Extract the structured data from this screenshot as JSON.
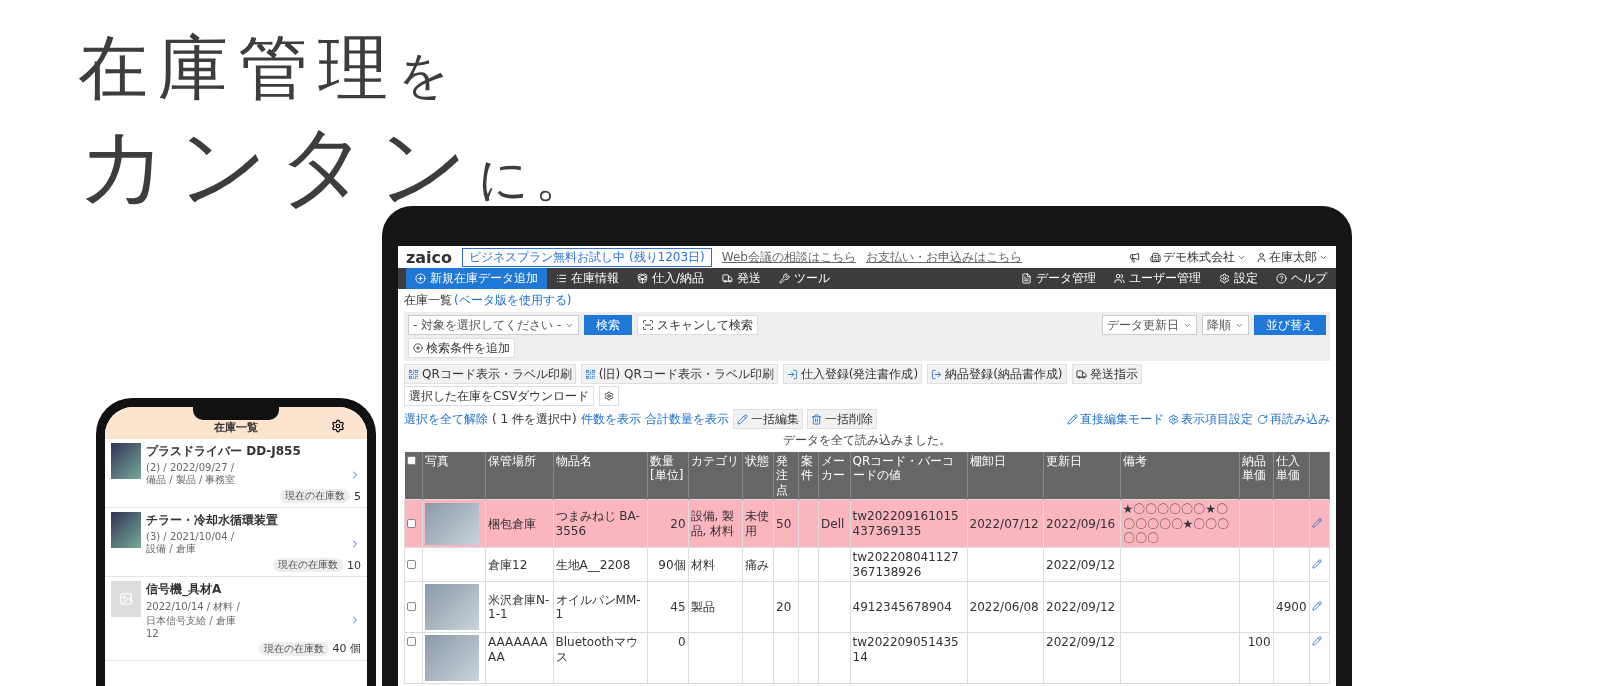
{
  "headline": [
    {
      "main": "在庫管理",
      "tail": "を"
    },
    {
      "main": "カンタン",
      "tail": "に。"
    }
  ],
  "app": {
    "logo": "zaico",
    "trial_badge": "ビジネスプラン無料お試し中 (残り1203日)",
    "top_links": [
      "Web会議の相談はこちら",
      "お支払い・お申込みはこちら"
    ],
    "company": "デモ株式会社",
    "user": "在庫太郎",
    "nav_left": [
      {
        "label": "新規在庫データ追加",
        "kind": "plus",
        "selected": true
      },
      {
        "label": "在庫情報",
        "kind": "list",
        "selected": false
      },
      {
        "label": "仕入/納品",
        "kind": "inbox",
        "selected": false
      },
      {
        "label": "発送",
        "kind": "truck",
        "selected": false
      },
      {
        "label": "ツール",
        "kind": "tool",
        "selected": false
      }
    ],
    "nav_right": [
      {
        "label": "データ管理",
        "kind": "data"
      },
      {
        "label": "ユーザー管理",
        "kind": "users"
      },
      {
        "label": "設定",
        "kind": "settings"
      },
      {
        "label": "ヘルプ",
        "kind": "help"
      }
    ],
    "page_title": "在庫一覧",
    "beta_link": "(ベータ版を使用する)",
    "search": {
      "target_select": "- 対象を選択してください -",
      "search_button": "検索",
      "scan_button": "スキャンして検索",
      "add_condition": "検索条件を追加",
      "sort_field": "データ更新日",
      "sort_order": "降順",
      "sort_button": "並び替え"
    },
    "actions": [
      {
        "label": "QRコード表示・ラベル印刷",
        "kind": "qr"
      },
      {
        "label": "(旧) QRコード表示・ラベル印刷",
        "kind": "qr"
      },
      {
        "label": "仕入登録(発注書作成)",
        "kind": "in"
      },
      {
        "label": "納品登録(納品書作成)",
        "kind": "out"
      },
      {
        "label": "発送指示",
        "kind": "truck"
      }
    ],
    "csv_button": "選択した在庫をCSVダウンロード",
    "selection": {
      "clear": "選択を全て解除",
      "count": "( 1 件を選択中)",
      "show_count": "件数を表示",
      "show_total": "合計数量を表示"
    },
    "bulk": [
      {
        "label": "一括編集",
        "kind": "edit"
      },
      {
        "label": "一括削除",
        "kind": "delete"
      }
    ],
    "view_links": [
      {
        "label": "直接編集モード",
        "kind": "edit"
      },
      {
        "label": "表示項目設定",
        "kind": "settings"
      },
      {
        "label": "再読み込み",
        "kind": "reload"
      }
    ],
    "message": "データを全て読み込みました。",
    "table": {
      "header_checked": false,
      "columns": [
        "写真",
        "保管場所",
        "物品名",
        "数量[単位]",
        "カテゴリ",
        "状態",
        "発注点",
        "案件",
        "メーカー",
        "QRコード・バーコードの値",
        "棚卸日",
        "更新日",
        "備考",
        "納品単価",
        "仕入単価"
      ],
      "rows": [
        {
          "checked": false,
          "highlighted": true,
          "has_photo": true,
          "cells": [
            null,
            "梱包倉庫",
            "つまみねじ BA-3556",
            "20",
            "設備, 製品, 材料",
            "未使用",
            "50",
            null,
            "Dell",
            "tw202209161015437369135",
            "2022/07/12",
            "2022/09/16",
            "★〇〇〇〇〇〇★〇〇〇〇〇〇★〇〇〇〇〇〇",
            null,
            null
          ]
        },
        {
          "checked": false,
          "highlighted": false,
          "has_photo": false,
          "cells": [
            null,
            "倉庫12",
            "生地A__2208",
            "90個",
            "材料",
            "痛み",
            null,
            null,
            null,
            "tw202208041127367138926",
            null,
            "2022/09/12",
            null,
            null,
            null
          ]
        },
        {
          "checked": false,
          "highlighted": false,
          "has_photo": true,
          "cells": [
            null,
            "米沢倉庫N-1-1",
            "オイルパンMM-1",
            "45",
            "製品",
            null,
            "20",
            null,
            null,
            "4912345678904",
            "2022/06/08",
            "2022/09/12",
            null,
            null,
            "4900"
          ]
        },
        {
          "checked": false,
          "highlighted": false,
          "has_photo": true,
          "cells": [
            null,
            "AAAAAAAAA",
            "Bluetoothマウス",
            "0",
            null,
            null,
            null,
            null,
            null,
            "tw20220905143514",
            null,
            "2022/09/12",
            null,
            "100",
            null
          ]
        }
      ]
    }
  },
  "phone": {
    "title": "在庫一覧",
    "items": [
      {
        "title": "プラスドライバー DD-J855",
        "meta": "(2) / 2022/09/27 / 備品 / 製品 / 事務室",
        "stock_label": "現在の在庫数",
        "stock": "5",
        "has_photo": true
      },
      {
        "title": "チラー・冷却水循環装置",
        "meta": "(3) / 2021/10/04 / 設備 / 倉庫",
        "stock_label": "現在の在庫数",
        "stock": "10",
        "has_photo": true
      },
      {
        "title": "信号機_具材A",
        "meta": "2022/10/14 / 材料 / 日本信号支給 / 倉庫12",
        "stock_label": "現在の在庫数",
        "stock": "40 個",
        "has_photo": false
      }
    ]
  }
}
